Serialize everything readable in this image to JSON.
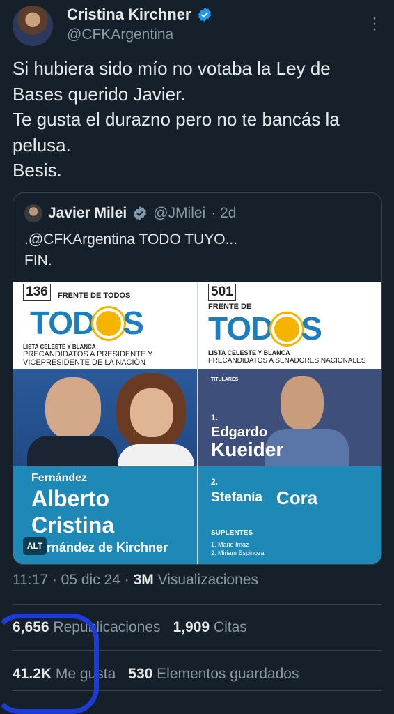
{
  "author": {
    "name": "Cristina Kirchner",
    "handle": "@CFKArgentina",
    "verified_color": "#1d9bf0"
  },
  "tweet": {
    "text": "Si hubiera sido mío no votaba la Ley de Bases querido Javier.\nTe gusta el durazno pero no te bancás la pelusa.\nBesis."
  },
  "quote": {
    "name": "Javier Milei",
    "handle": "@JMilei",
    "time": "· 2d",
    "text": ".@CFKArgentina TODO TUYO...\nFIN.",
    "image": {
      "left": {
        "list_number": "136",
        "front": "FRENTE DE TODOS",
        "logo_left": "TOD",
        "logo_right": "S",
        "list_label": "LISTA CELESTE Y BLANCA",
        "subtitle": "PRECANDIDATOS A PRESIDENTE Y VICEPRESIDENTE DE LA NACIÓN",
        "candidate_small": "Fernández",
        "candidate_big1": "Alberto",
        "candidate_big2": "Cristina",
        "candidate_tail": "rnández de Kirchner"
      },
      "right": {
        "list_number": "501",
        "front": "FRENTE DE",
        "logo_left": "TOD",
        "logo_right": "S",
        "list_label": "LISTA CELESTE Y BLANCA",
        "subtitle": "PRECANDIDATOS A SENADORES NACIONALES",
        "titulares": "TITULARES",
        "n1": "1.",
        "first1": "Edgardo",
        "last1": "Kueider",
        "n2": "2.",
        "first2": "Stefanía",
        "last2": "Cora",
        "suplentes": "SUPLENTES",
        "sup1": "1. Mario Imaz",
        "sup2": "2. Miriam Espinoza"
      },
      "alt_badge": "ALT"
    }
  },
  "meta": {
    "time": "11:17",
    "date": "· 05 dic 24 ·",
    "views_count": "3M",
    "views_label": "Visualizaciones"
  },
  "stats": {
    "reposts_count": "6,656",
    "reposts_label": "Republicaciones",
    "quotes_count": "1,909",
    "quotes_label": "Citas",
    "likes_count": "41.2K",
    "likes_label": "Me gusta",
    "bookmarks_count": "530",
    "bookmarks_label": "Elementos guardados"
  }
}
